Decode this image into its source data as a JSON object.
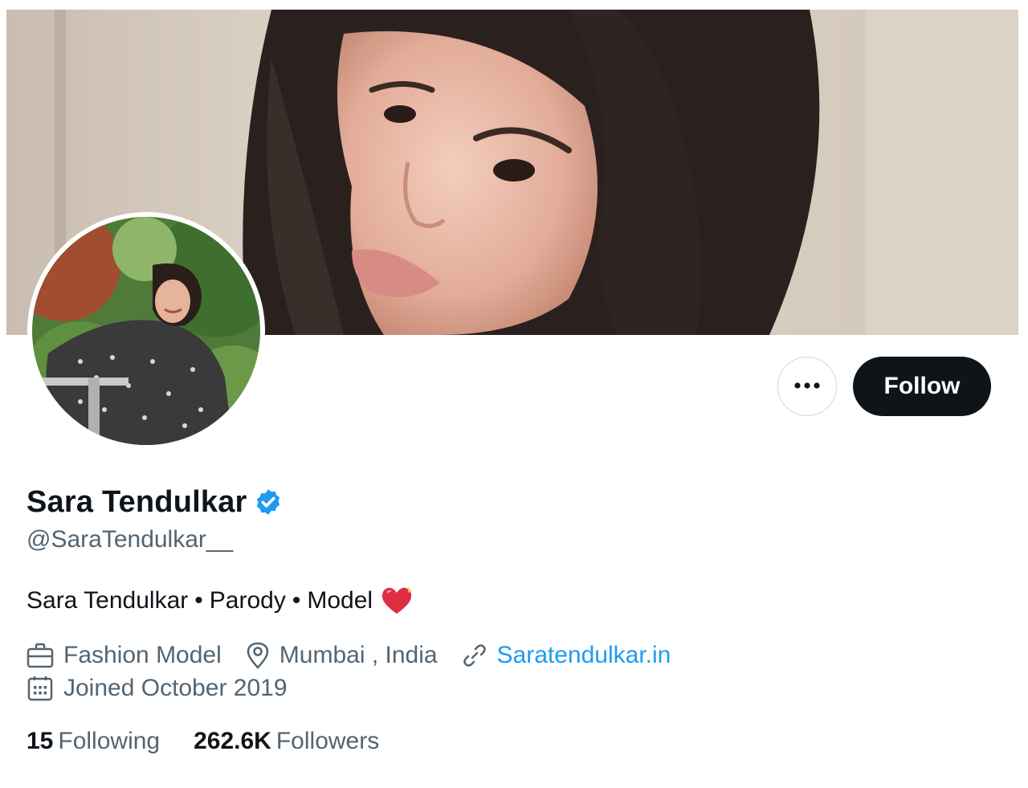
{
  "profile": {
    "display_name": "Sara Tendulkar",
    "handle": "@SaraTendulkar__",
    "verified": true,
    "bio": {
      "part1": "Sara Tendulkar",
      "separator1": "•",
      "part2": "Parody",
      "separator2": "•",
      "part3": "Model",
      "emoji": "heart-icon"
    },
    "category": "Fashion Model",
    "location": "Mumbai , India",
    "website": "Saratendulkar.in",
    "joined": "Joined October 2019",
    "following_count": "15",
    "following_label": "Following",
    "followers_count": "262.6K",
    "followers_label": "Followers"
  },
  "actions": {
    "follow_label": "Follow",
    "more_icon": "more-dots-icon"
  },
  "colors": {
    "accent": "#1d9bf0",
    "text_primary": "#0f1419",
    "text_secondary": "#536471",
    "button_dark": "#0f1419"
  }
}
